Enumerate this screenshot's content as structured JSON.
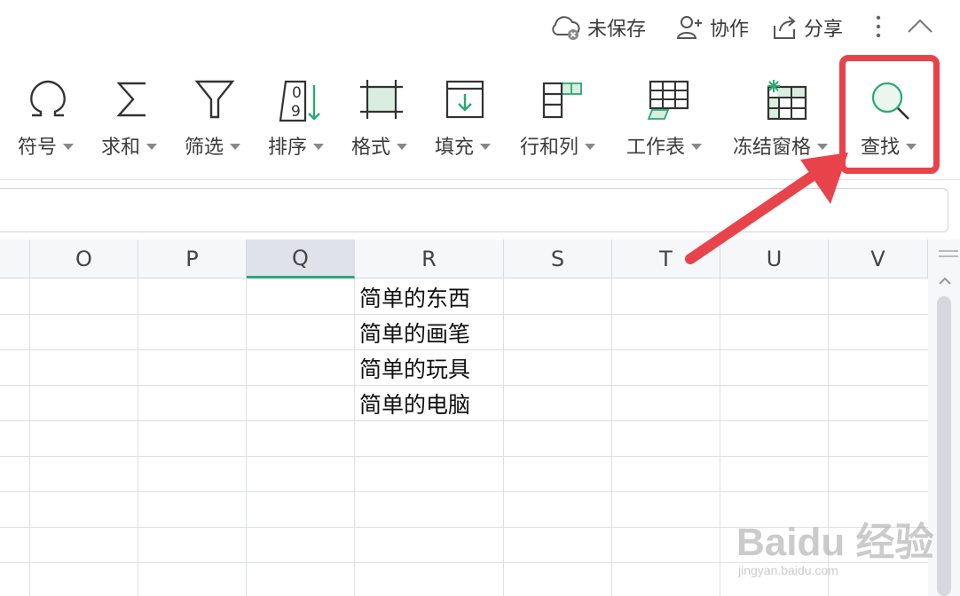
{
  "topbar": {
    "unsaved_label": "未保存",
    "collaborate_label": "协作",
    "share_label": "分享"
  },
  "ribbon": {
    "symbol_label": "符号",
    "sum_label": "求和",
    "filter_label": "筛选",
    "sort_label": "排序",
    "sort_icon_digits": [
      "0",
      "9"
    ],
    "format_label": "格式",
    "fill_label": "填充",
    "rowcol_label": "行和列",
    "sheet_label": "工作表",
    "freeze_label": "冻结窗格",
    "find_label": "查找"
  },
  "grid": {
    "columns": [
      "O",
      "P",
      "Q",
      "R",
      "S",
      "T",
      "U",
      "V"
    ],
    "selected_column": "Q",
    "cells_r": [
      "简单的东西",
      "简单的画笔",
      "简单的玩具",
      "简单的电脑"
    ]
  },
  "watermark": {
    "big": "Baidu 经验",
    "small": "jingyan.baidu.com"
  },
  "colors": {
    "accent_green": "#2aa876",
    "annotation_red": "#e8434a",
    "selected_header": "#dfe2e8"
  }
}
